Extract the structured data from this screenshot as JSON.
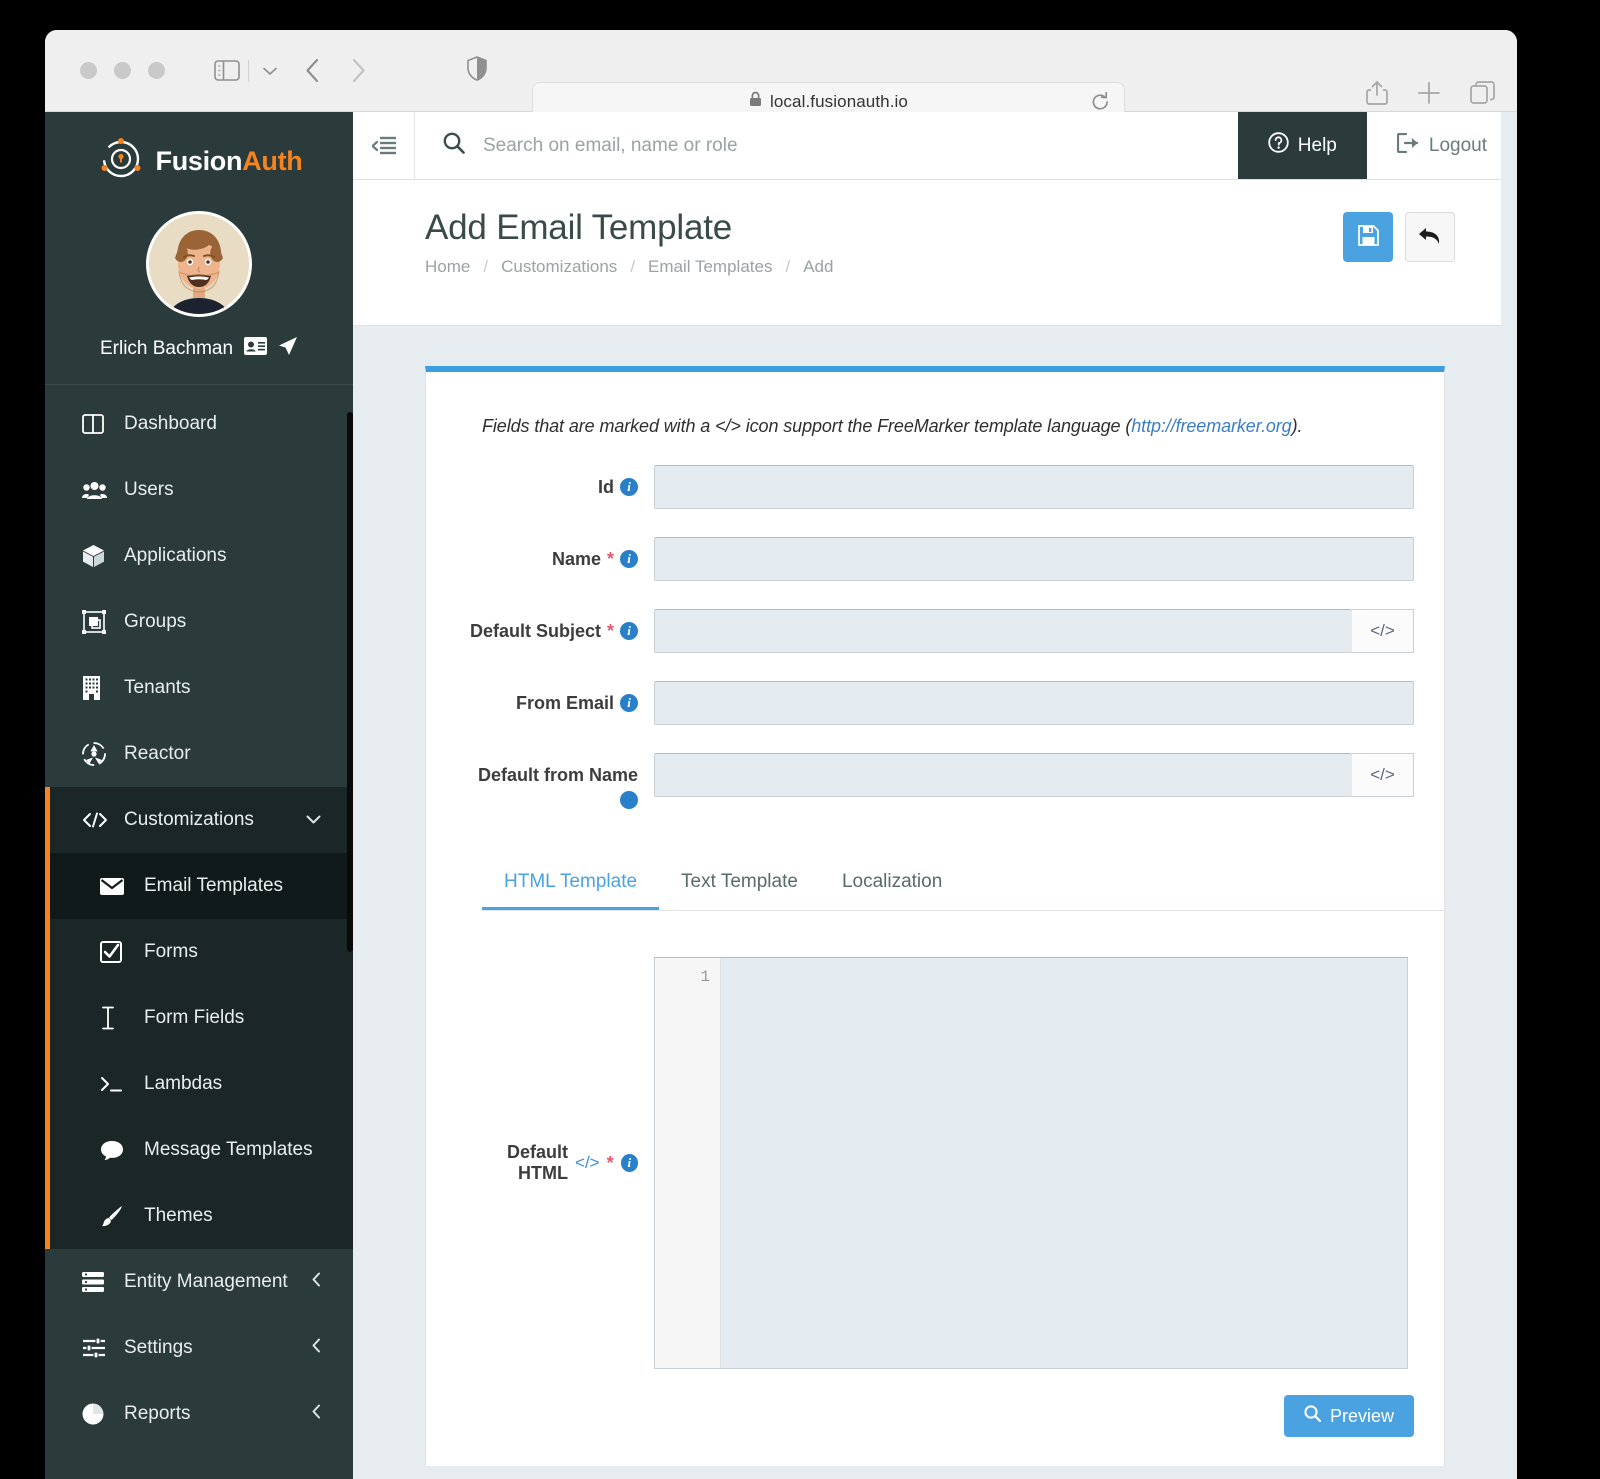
{
  "browser": {
    "url": "local.fusionauth.io",
    "lock_icon": "lock-icon",
    "reload_icon": "reload-icon",
    "share_icon": "share-icon",
    "newtab_icon": "plus-icon",
    "tabs_icon": "tab-overview-icon",
    "back_icon": "chevron-left-icon",
    "forward_icon": "chevron-right-icon",
    "sidebar_icon": "sidebar-toggle-icon",
    "shield_icon": "privacy-shield-icon"
  },
  "sidebar": {
    "logo": {
      "first": "Fusion",
      "second": "Auth"
    },
    "user": {
      "name": "Erlich Bachman",
      "badge_icon": "id-card-icon",
      "impersonate_icon": "paper-plane-icon"
    },
    "items": [
      {
        "label": "Dashboard",
        "icon": "dashboard-icon"
      },
      {
        "label": "Users",
        "icon": "users-icon"
      },
      {
        "label": "Applications",
        "icon": "cube-icon"
      },
      {
        "label": "Groups",
        "icon": "groups-icon"
      },
      {
        "label": "Tenants",
        "icon": "building-icon"
      },
      {
        "label": "Reactor",
        "icon": "reactor-icon"
      }
    ],
    "customizations": {
      "label": "Customizations",
      "icon": "code-icon",
      "caret": "chevron-down-icon",
      "children": [
        {
          "label": "Email Templates",
          "icon": "envelope-icon",
          "active": true
        },
        {
          "label": "Forms",
          "icon": "checkbox-icon",
          "active": false
        },
        {
          "label": "Form Fields",
          "icon": "text-cursor-icon",
          "active": false
        },
        {
          "label": "Lambdas",
          "icon": "terminal-icon",
          "active": false
        },
        {
          "label": "Message Templates",
          "icon": "chat-bubble-icon",
          "active": false
        },
        {
          "label": "Themes",
          "icon": "paintbrush-icon",
          "active": false
        }
      ]
    },
    "bottom_items": [
      {
        "label": "Entity Management",
        "icon": "server-icon",
        "caret": "chevron-left-icon"
      },
      {
        "label": "Settings",
        "icon": "sliders-icon",
        "caret": "chevron-left-icon"
      },
      {
        "label": "Reports",
        "icon": "pie-chart-icon",
        "caret": "chevron-left-icon"
      }
    ]
  },
  "topbar": {
    "menu_icon": "collapse-menu-icon",
    "search_icon": "search-icon",
    "search_placeholder": "Search on email, name or role",
    "search_value": "",
    "help_label": "Help",
    "help_icon": "question-circle-icon",
    "logout_label": "Logout",
    "logout_icon": "sign-out-icon"
  },
  "page": {
    "title": "Add Email Template",
    "breadcrumbs": [
      "Home",
      "Customizations",
      "Email Templates",
      "Add"
    ],
    "separator": "/",
    "save_icon": "floppy-save-icon",
    "back_icon": "undo-arrow-icon"
  },
  "form": {
    "note_before": "Fields that are marked with a ",
    "note_code": "</>",
    "note_middle": " icon support the FreeMarker template language (",
    "note_link": "http://freemarker.org",
    "note_after": ").",
    "fields": [
      {
        "label": "Id",
        "required": false,
        "value": "",
        "placeholder": "",
        "code": false,
        "info": "info-icon"
      },
      {
        "label": "Name",
        "required": true,
        "value": "",
        "placeholder": "",
        "code": false,
        "info": "info-icon"
      },
      {
        "label": "Default Subject",
        "required": true,
        "value": "",
        "placeholder": "",
        "code": true,
        "info": "info-icon"
      },
      {
        "label": "From Email",
        "required": false,
        "value": "",
        "placeholder": "",
        "code": false,
        "info": "info-icon"
      },
      {
        "label": "Default from Name",
        "required": false,
        "value": "",
        "placeholder": "",
        "code": true,
        "info": "info-icon"
      }
    ],
    "code_adorn_glyph": "</>"
  },
  "tabs": [
    {
      "label": "HTML Template",
      "active": true
    },
    {
      "label": "Text Template",
      "active": false
    },
    {
      "label": "Localization",
      "active": false
    }
  ],
  "editor": {
    "label": "Default HTML",
    "code_glyph": "</>",
    "required_mark": "*",
    "info": "info-icon",
    "line_number": "1",
    "value": "",
    "preview_label": "Preview",
    "preview_icon": "magnifier-icon"
  },
  "colors": {
    "accent_blue": "#4aa3e0",
    "panel_top_border": "#3c9ee0",
    "sidebar_bg": "#2b3a3a",
    "sidebar_active": "#111a1a",
    "brand_orange": "#f58320",
    "required_red": "#e8566f",
    "page_bg": "#e7ecf0"
  }
}
